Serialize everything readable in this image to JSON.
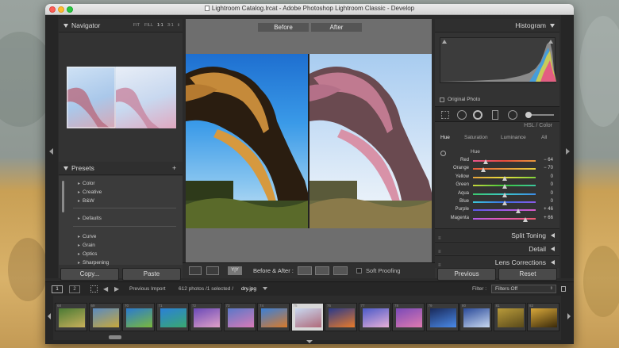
{
  "window": {
    "title": "Lightroom Catalog.lrcat - Adobe Photoshop Lightroom Classic - Develop"
  },
  "navigator": {
    "title": "Navigator",
    "zoom_options": [
      "FIT",
      "FILL",
      "1:1",
      "3:1"
    ]
  },
  "presets": {
    "title": "Presets",
    "items": [
      "Color",
      "Creative",
      "B&W",
      "Defaults",
      "Curve",
      "Grain",
      "Optics",
      "Sharpening"
    ]
  },
  "left_buttons": {
    "copy": "Copy...",
    "paste": "Paste"
  },
  "compare": {
    "before": "Before",
    "after": "After"
  },
  "toolbar": {
    "view_yy": "Y|Y",
    "before_after_label": "Before & After :",
    "soft_proofing": "Soft Proofing"
  },
  "histogram": {
    "title": "Histogram",
    "original_photo": "Original Photo"
  },
  "hsl": {
    "section_title": "HSL / Color",
    "tabs": [
      "Hue",
      "Saturation",
      "Luminance",
      "All"
    ],
    "active_tab": "Hue",
    "group_label": "Hue",
    "rows": [
      {
        "label": "Red",
        "value": "− 64",
        "fraction": 0.2,
        "colors": [
          "#e8568d",
          "#e84c3c",
          "#e89a3c"
        ]
      },
      {
        "label": "Orange",
        "value": "− 70",
        "fraction": 0.17,
        "colors": [
          "#e85a3c",
          "#e8963c",
          "#e8d23c"
        ]
      },
      {
        "label": "Yellow",
        "value": "0",
        "fraction": 0.5,
        "colors": [
          "#e8a43c",
          "#e8e03c",
          "#7fd23c"
        ]
      },
      {
        "label": "Green",
        "value": "0",
        "fraction": 0.5,
        "colors": [
          "#c8d83c",
          "#3cc83c",
          "#3cc8a0"
        ]
      },
      {
        "label": "Aqua",
        "value": "0",
        "fraction": 0.5,
        "colors": [
          "#3cc86e",
          "#3cc8c8",
          "#3c8ce8"
        ]
      },
      {
        "label": "Blue",
        "value": "0",
        "fraction": 0.5,
        "colors": [
          "#3cc8d8",
          "#3c6ee8",
          "#8a5ae8"
        ]
      },
      {
        "label": "Purple",
        "value": "+ 46",
        "fraction": 0.72,
        "colors": [
          "#5a5ae8",
          "#a05ae8",
          "#d85ac8"
        ]
      },
      {
        "label": "Magenta",
        "value": "+ 66",
        "fraction": 0.83,
        "colors": [
          "#b45ae8",
          "#e85ab4",
          "#e85a6e"
        ]
      }
    ]
  },
  "right_sections": {
    "split_toning": "Split Toning",
    "detail": "Detail",
    "lens_corrections": "Lens Corrections"
  },
  "right_buttons": {
    "previous": "Previous",
    "reset": "Reset"
  },
  "filmstrip_bar": {
    "page1": "1",
    "page2": "2",
    "source": "Previous Import",
    "count": "612 photos /1 selected /",
    "filename": "dry.jpg",
    "filter_label": "Filter :",
    "filter_value": "Filters Off"
  },
  "filmstrip": {
    "selected_index": 7,
    "thumbs": [
      {
        "num": "68",
        "c1": "#4a7a35",
        "c2": "#c8b05a"
      },
      {
        "num": "69",
        "c1": "#5a8ac0",
        "c2": "#c8a83c"
      },
      {
        "num": "70",
        "c1": "#2a7ad0",
        "c2": "#7ab83c"
      },
      {
        "num": "71",
        "c1": "#2a80d8",
        "c2": "#3aa870"
      },
      {
        "num": "72",
        "c1": "#6a4ab8",
        "c2": "#e0a0c8"
      },
      {
        "num": "73",
        "c1": "#5a78c8",
        "c2": "#d87ab8"
      },
      {
        "num": "74",
        "c1": "#3a80d8",
        "c2": "#d87a2a"
      },
      {
        "num": "75",
        "c1": "#c8d8f0",
        "c2": "#b06a7a"
      },
      {
        "num": "76",
        "c1": "#2a3a8a",
        "c2": "#e87a2a"
      },
      {
        "num": "77",
        "c1": "#4a5ac8",
        "c2": "#e8b0d8"
      },
      {
        "num": "78",
        "c1": "#7a4ab8",
        "c2": "#e07ab0"
      },
      {
        "num": "79",
        "c1": "#1a2a5a",
        "c2": "#4a8ae8"
      },
      {
        "num": "80",
        "c1": "#2a4a9a",
        "c2": "#c8d8f0"
      },
      {
        "num": "81",
        "c1": "#b89a3a",
        "c2": "#5a4a1a"
      },
      {
        "num": "82",
        "c1": "#d8a83a",
        "c2": "#3a2a0a"
      }
    ]
  }
}
